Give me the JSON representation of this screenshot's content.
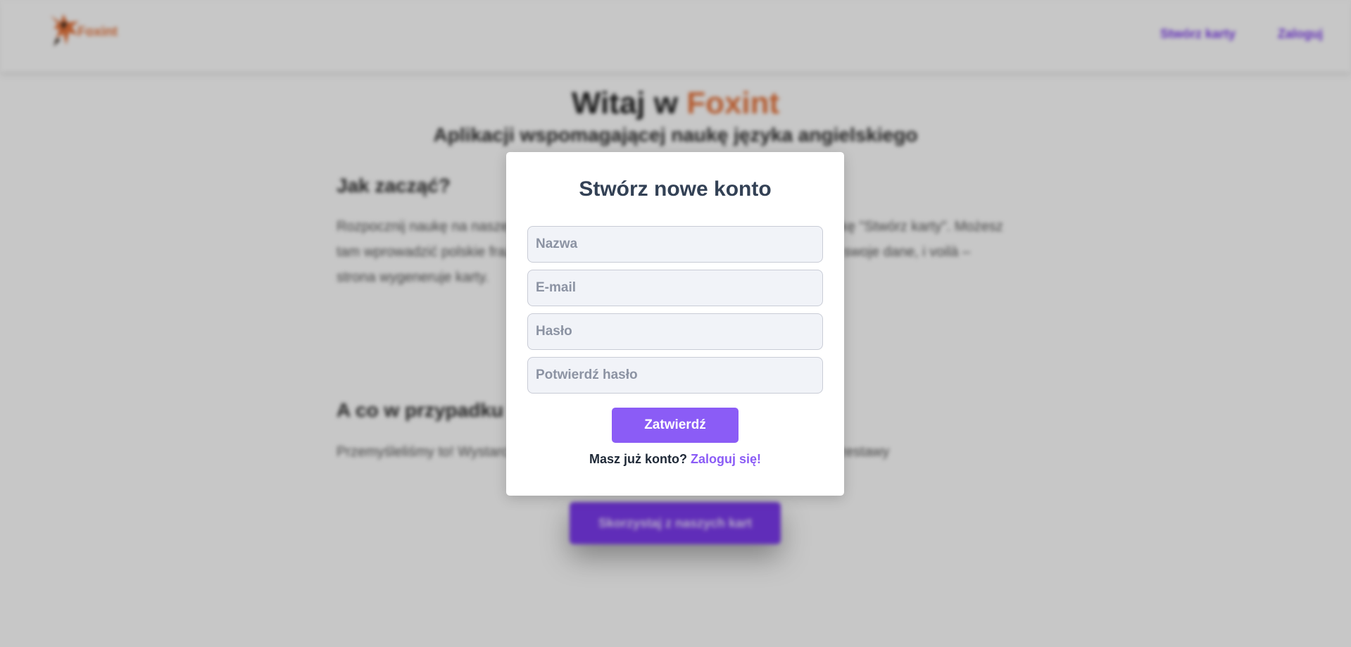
{
  "header": {
    "logo_text": "Foxint",
    "nav": [
      {
        "label": "Stwórz karty"
      },
      {
        "label": "Zaloguj"
      }
    ]
  },
  "hero": {
    "title_prefix": "Witaj w ",
    "title_brand": "Foxint",
    "subtitle": "Aplikacji wspomagającej naukę języka angielskiego"
  },
  "sections": [
    {
      "heading": "Jak zacząć?",
      "text": "Rozpocznij naukę na naszej stronie klikając poniższy przycisk lub wybierz zakładkę \"Stwórz karty\". Możesz tam wprowadzić polskie frazy, a nasza strona dokona ich tłumaczenia. Potwierdź swoje dane, i voilà – strona wygeneruje karty."
    },
    {
      "heading": "A co w przypadku",
      "text": "Przemyśleliśmy to! Wystarczy, że klikniesz poniższy przycisk, gdzie znajdują się zestawy"
    }
  ],
  "cta": {
    "label": "Skorzystaj z naszych kart"
  },
  "modal": {
    "title": "Stwórz nowe konto",
    "fields": {
      "name_placeholder": "Nazwa",
      "email_placeholder": "E-mail",
      "password_placeholder": "Hasło",
      "confirm_placeholder": "Potwierdź hasło"
    },
    "submit_label": "Zatwierdź",
    "login_prompt": "Masz już konto?",
    "login_link": "Zaloguj się!"
  },
  "colors": {
    "accent": "#8b5cf6",
    "brand": "#e7753d",
    "heading": "#334155"
  }
}
